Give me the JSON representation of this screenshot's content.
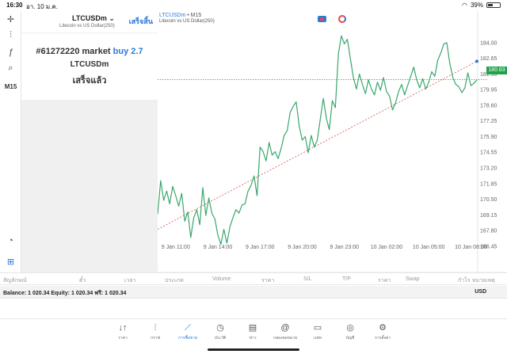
{
  "status": {
    "time": "16:30",
    "date": "อา. 10 ม.ค.",
    "battery": "39%"
  },
  "tools": {
    "timeframe": "M15"
  },
  "header": {
    "symbol": "LTCUSDm",
    "description": "Litecoin vs US Dollar(250)",
    "done_label": "เสร็จสิ้น"
  },
  "order": {
    "ticket": "#61272220 market",
    "action": "buy 2.7",
    "symbol": "LTCUSDm",
    "status": "เสร็จแล้ว"
  },
  "chart_header": {
    "symbol": "LTCUSDm",
    "timeframe": "M15",
    "description": "Litecoin vs US Dollar(250)"
  },
  "chart_data": {
    "type": "line",
    "current_price": "180.83",
    "ylim": [
      165.0,
      185.5
    ],
    "y_ticks": [
      "184.00",
      "182.65",
      "181.30",
      "179.95",
      "178.60",
      "177.25",
      "175.90",
      "174.55",
      "173.20",
      "171.85",
      "170.50",
      "169.15",
      "167.80",
      "166.45"
    ],
    "y_tick_values": [
      184.0,
      182.65,
      181.3,
      179.95,
      178.6,
      177.25,
      175.9,
      174.55,
      173.2,
      171.85,
      170.5,
      169.15,
      167.8,
      166.45
    ],
    "x_ticks": [
      "9 Jan 11:00",
      "9 Jan 14:00",
      "9 Jan 17:00",
      "9 Jan 20:00",
      "9 Jan 23:00",
      "10 Jan 02:00",
      "10 Jan 05:00",
      "10 Jan 08:00"
    ],
    "x_tick_index": [
      6,
      20,
      34,
      48,
      62,
      76,
      90,
      104
    ],
    "close": [
      169.2,
      172.1,
      170.4,
      171.2,
      170.1,
      171.6,
      170.8,
      169.9,
      171.0,
      168.6,
      169.4,
      167.2,
      168.9,
      169.6,
      168.3,
      171.5,
      169.1,
      170.6,
      169.3,
      168.8,
      167.4,
      166.6,
      167.9,
      166.7,
      168.1,
      168.9,
      169.6,
      169.3,
      170.0,
      170.1,
      171.2,
      171.7,
      172.5,
      170.8,
      175.0,
      174.6,
      173.8,
      175.4,
      174.3,
      174.6,
      174.0,
      174.9,
      176.0,
      176.4,
      178.0,
      178.5,
      178.9,
      176.8,
      175.6,
      175.9,
      174.5,
      176.0,
      175.0,
      175.6,
      177.4,
      179.2,
      177.5,
      176.5,
      179.0,
      178.4,
      183.0,
      184.6,
      183.9,
      184.3,
      182.6,
      181.0,
      180.0,
      181.3,
      180.4,
      179.6,
      180.8,
      180.0,
      179.5,
      180.6,
      179.9,
      181.0,
      179.8,
      179.4,
      178.2,
      178.8,
      179.8,
      180.4,
      179.5,
      180.3,
      181.1,
      181.9,
      180.8,
      180.1,
      180.9,
      180.0,
      180.6,
      181.5,
      181.1,
      182.5,
      183.1,
      183.9,
      184.0,
      182.2,
      181.0,
      180.4,
      180.2,
      179.7,
      180.1,
      181.4,
      180.3,
      180.5,
      180.8
    ],
    "trendline": {
      "start_price": 167.9,
      "end_price": 182.4
    },
    "colors": {
      "line": "#3aa76d",
      "trend": "#d9534f",
      "price_line": "#1fa34a"
    }
  },
  "trade_columns": [
    "สัญลักษณ์",
    "ตั๋ว",
    "เวลา",
    "ประเภท",
    "Volume",
    "ราคา",
    "S/L",
    "T/P",
    "ราคา",
    "Swap",
    "กำไร",
    "หมายเหตุ"
  ],
  "balance": {
    "text": "Balance: 1 020.34 Equity: 1 020.34 ฟรี: 1 020.34",
    "currency": "USD"
  },
  "nav": [
    {
      "label": "ราคา",
      "icon": "↓↑"
    },
    {
      "label": "กราฟ",
      "icon": "⫶"
    },
    {
      "label": "การซื้อขาย",
      "icon": "⟋"
    },
    {
      "label": "ประวัติ",
      "icon": "◷"
    },
    {
      "label": "ข่าว",
      "icon": "▤"
    },
    {
      "label": "กล่องจดหมาย",
      "icon": "@"
    },
    {
      "label": "แชท",
      "icon": "▭"
    },
    {
      "label": "บัญชี",
      "icon": "◎"
    },
    {
      "label": "การตั้งค่า",
      "icon": "⚙"
    }
  ]
}
